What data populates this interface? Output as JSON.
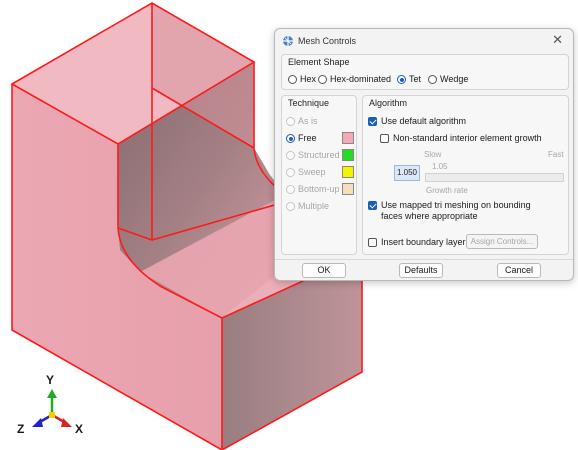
{
  "dialog": {
    "title": "Mesh Controls",
    "close_glyph": "✕",
    "icon": "mesh-app-icon"
  },
  "element_shape": {
    "title": "Element Shape",
    "options": [
      "Hex",
      "Hex-dominated",
      "Tet",
      "Wedge"
    ],
    "selected": "Tet"
  },
  "technique": {
    "title": "Technique",
    "options": [
      {
        "label": "As is",
        "enabled": false,
        "selected": false,
        "color": ""
      },
      {
        "label": "Free",
        "enabled": true,
        "selected": true,
        "color": "#f4a9b8"
      },
      {
        "label": "Structured",
        "enabled": false,
        "selected": false,
        "color": "#22dd22"
      },
      {
        "label": "Sweep",
        "enabled": false,
        "selected": false,
        "color": "#f4f400"
      },
      {
        "label": "Bottom-up",
        "enabled": false,
        "selected": false,
        "color": "#f5deb8"
      },
      {
        "label": "Multiple",
        "enabled": false,
        "selected": false,
        "color": ""
      }
    ]
  },
  "algorithm": {
    "title": "Algorithm",
    "use_default_label": "Use default algorithm",
    "use_default_checked": true,
    "non_standard_label": "Non-standard interior element growth",
    "non_standard_checked": false,
    "slow_label": "Slow",
    "fast_label": "Fast",
    "slider_value_label": "1.05",
    "growth_value": "1.050",
    "growth_rate_label": "Growth rate",
    "mapped_tri_label_line1": "Use mapped tri meshing on bounding",
    "mapped_tri_label_line2": "faces where appropriate",
    "mapped_tri_checked": true,
    "boundary_layer_label": "Insert boundary layer",
    "boundary_layer_checked": false,
    "assign_controls_label": "Assign Controls..."
  },
  "buttons": {
    "ok": "OK",
    "defaults": "Defaults",
    "cancel": "Cancel"
  },
  "triad": {
    "y": "Y",
    "z": "Z",
    "x": "X",
    "colors": {
      "y": "#22aa22",
      "x": "#dd2222",
      "z": "#2222cc"
    }
  },
  "model": {
    "face_color": "#e8a0ac",
    "edge_color": "#ff0000"
  }
}
